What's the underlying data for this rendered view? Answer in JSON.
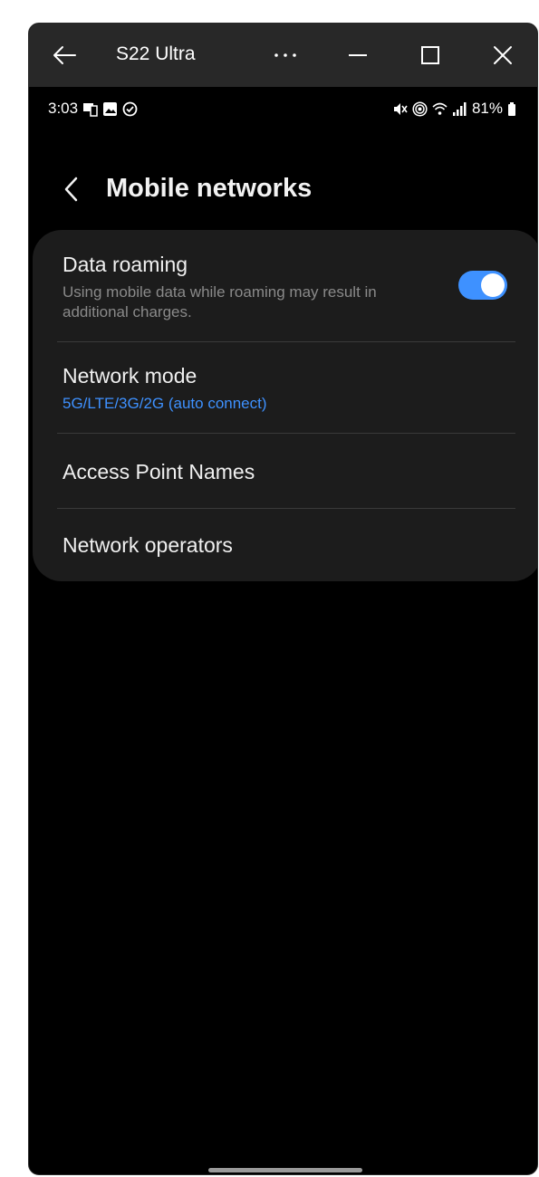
{
  "window": {
    "title": "S22 Ultra",
    "more_label": "···"
  },
  "statusbar": {
    "time": "3:03",
    "battery": "81%"
  },
  "header": {
    "title": "Mobile networks"
  },
  "settings": {
    "data_roaming": {
      "title": "Data roaming",
      "subtitle": "Using mobile data while roaming may result in additional charges.",
      "enabled": true
    },
    "network_mode": {
      "title": "Network mode",
      "value": "5G/LTE/3G/2G (auto connect)"
    },
    "access_point_names": {
      "title": "Access Point Names"
    },
    "network_operators": {
      "title": "Network operators"
    }
  },
  "colors": {
    "accent": "#3e91ff",
    "card_bg": "#1c1c1c",
    "titlebar_bg": "#282828"
  }
}
